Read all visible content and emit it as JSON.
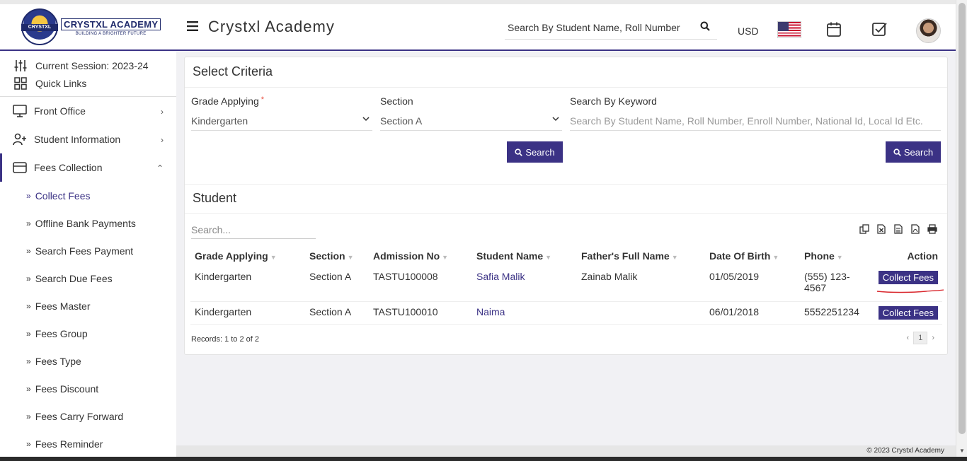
{
  "header": {
    "logo_title": "CRYSTXL ACADEMY",
    "logo_subtitle": "BUILDING A BRIGHTER FUTURE",
    "logo_badge": "CRYSTXL",
    "app_title": "Crystxl Academy",
    "search_placeholder": "Search By Student Name, Roll Number",
    "currency": "USD",
    "icons": [
      "menu-icon",
      "search-icon",
      "us-flag-icon",
      "calendar-icon",
      "task-check-icon",
      "user-avatar"
    ]
  },
  "sidebar": {
    "session": "Current Session: 2023-24",
    "quick_links": "Quick Links",
    "items": [
      {
        "label": "Front Office",
        "icon": "monitor-icon",
        "chevron": "›"
      },
      {
        "label": "Student Information",
        "icon": "user-plus-icon",
        "chevron": "›"
      },
      {
        "label": "Fees Collection",
        "icon": "card-icon",
        "chevron": "⌃"
      }
    ],
    "sub_items": [
      "Collect Fees",
      "Offline Bank Payments",
      "Search Fees Payment",
      "Search Due Fees",
      "Fees Master",
      "Fees Group",
      "Fees Type",
      "Fees Discount",
      "Fees Carry Forward",
      "Fees Reminder"
    ],
    "arrow": "»"
  },
  "criteria": {
    "title": "Select Criteria",
    "grade_label": "Grade Applying",
    "required_mark": "*",
    "grade_value": "Kindergarten",
    "section_label": "Section",
    "section_value": "Section A",
    "keyword_label": "Search By Keyword",
    "keyword_placeholder": "Search By Student Name, Roll Number, Enroll Number, National Id, Local Id Etc.",
    "search_button": "Search",
    "search_button_2": "Search"
  },
  "student": {
    "title": "Student",
    "search_placeholder": "Search...",
    "columns": [
      "Grade Applying",
      "Section",
      "Admission No",
      "Student Name",
      "Father's Full Name",
      "Date Of Birth",
      "Phone",
      "Action"
    ],
    "rows": [
      {
        "grade": "Kindergarten",
        "section": "Section A",
        "admission": "TASTU100008",
        "name": "Safia Malik",
        "father": "Zainab Malik",
        "dob": "01/05/2019",
        "phone": "(555) 123-4567",
        "action": "Collect Fees"
      },
      {
        "grade": "Kindergarten",
        "section": "Section A",
        "admission": "TASTU100010",
        "name": "Naima",
        "father": "",
        "dob": "06/01/2018",
        "phone": "5552251234",
        "action": "Collect Fees"
      }
    ],
    "records": "Records: 1 to 2 of 2",
    "prev": "‹",
    "page": "1",
    "next": "›"
  },
  "footer": {
    "text": "© 2023 Crystxl Academy"
  },
  "colors": {
    "accent": "#3b3285",
    "required": "#e74c3c",
    "annotation": "#d9262c"
  }
}
